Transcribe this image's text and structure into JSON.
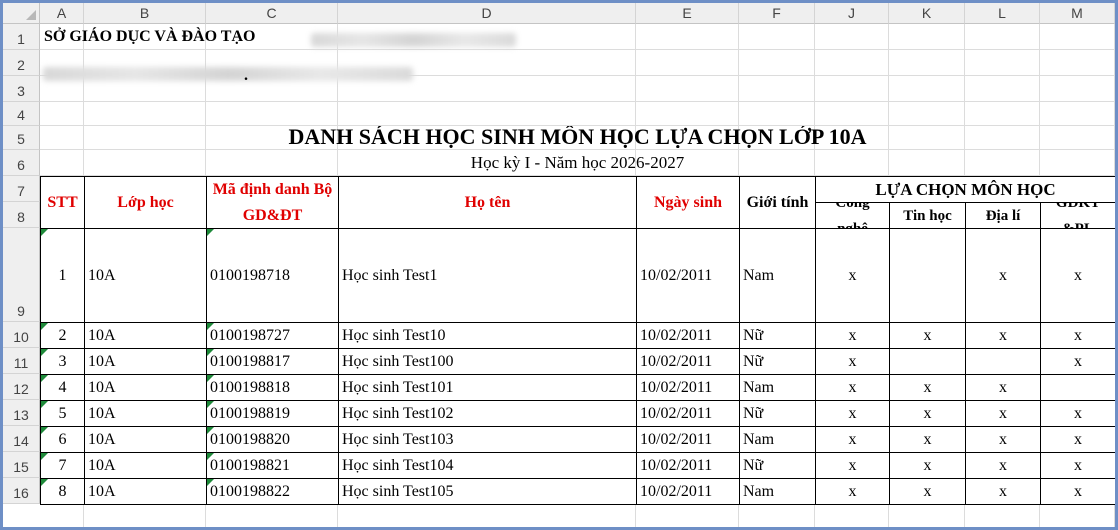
{
  "columns": [
    "A",
    "B",
    "C",
    "D",
    "E",
    "F",
    "J",
    "K",
    "L",
    "M"
  ],
  "rows": [
    "1",
    "2",
    "3",
    "4",
    "5",
    "6",
    "7",
    "8",
    "9",
    "10",
    "11",
    "12",
    "13",
    "14",
    "15",
    "16"
  ],
  "header_line1": "SỞ GIÁO DỤC VÀ ĐÀO TẠO",
  "header_line2_dot": ".",
  "title": "DANH SÁCH HỌC SINH MÔN HỌC LỰA CHỌN LỚP 10A",
  "subtitle": "Học kỳ I - Năm học 2026-2027",
  "table_headers": {
    "stt": "STT",
    "lop": "Lớp học",
    "ma": "Mã định danh Bộ GD&ĐT",
    "hoten": "Họ tên",
    "ngaysinh": "Ngày sinh",
    "gioitinh": "Giới tính",
    "group": "LỰA CHỌN MÔN HỌC",
    "congnghe": "Công nghệ",
    "tinhoc": "Tin học",
    "diali": "Địa lí",
    "gdkt": "GDKT &PL"
  },
  "students": [
    {
      "stt": "1",
      "lop": "10A",
      "ma": "0100198718",
      "ten": "Học sinh Test1",
      "ns": "10/02/2011",
      "gt": "Nam",
      "cn": "x",
      "th": "",
      "dl": "x",
      "gd": "x"
    },
    {
      "stt": "2",
      "lop": "10A",
      "ma": "0100198727",
      "ten": "Học sinh Test10",
      "ns": "10/02/2011",
      "gt": "Nữ",
      "cn": "x",
      "th": "x",
      "dl": "x",
      "gd": "x"
    },
    {
      "stt": "3",
      "lop": "10A",
      "ma": "0100198817",
      "ten": "Học sinh Test100",
      "ns": "10/02/2011",
      "gt": "Nữ",
      "cn": "x",
      "th": "",
      "dl": "",
      "gd": "x"
    },
    {
      "stt": "4",
      "lop": "10A",
      "ma": "0100198818",
      "ten": "Học sinh Test101",
      "ns": "10/02/2011",
      "gt": "Nam",
      "cn": "x",
      "th": "x",
      "dl": "x",
      "gd": ""
    },
    {
      "stt": "5",
      "lop": "10A",
      "ma": "0100198819",
      "ten": "Học sinh Test102",
      "ns": "10/02/2011",
      "gt": "Nữ",
      "cn": "x",
      "th": "x",
      "dl": "x",
      "gd": "x"
    },
    {
      "stt": "6",
      "lop": "10A",
      "ma": "0100198820",
      "ten": "Học sinh Test103",
      "ns": "10/02/2011",
      "gt": "Nam",
      "cn": "x",
      "th": "x",
      "dl": "x",
      "gd": "x"
    },
    {
      "stt": "7",
      "lop": "10A",
      "ma": "0100198821",
      "ten": "Học sinh Test104",
      "ns": "10/02/2011",
      "gt": "Nữ",
      "cn": "x",
      "th": "x",
      "dl": "x",
      "gd": "x"
    },
    {
      "stt": "8",
      "lop": "10A",
      "ma": "0100198822",
      "ten": "Học sinh Test105",
      "ns": "10/02/2011",
      "gt": "Nam",
      "cn": "x",
      "th": "x",
      "dl": "x",
      "gd": "x"
    }
  ]
}
